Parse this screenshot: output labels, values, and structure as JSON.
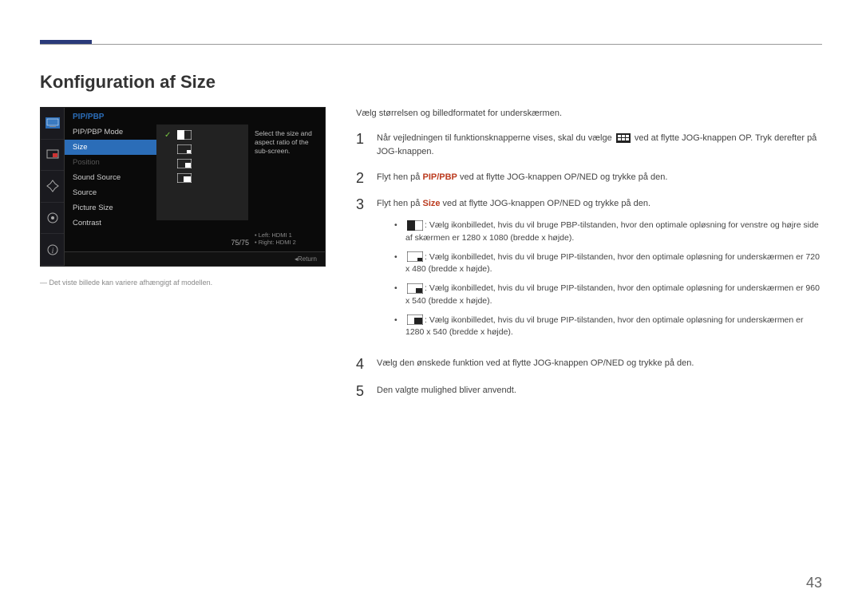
{
  "page": {
    "heading": "Konfiguration af Size",
    "caption": "Det viste billede kan variere afhængigt af modellen.",
    "page_number": "43"
  },
  "osd": {
    "title": "PIP/PBP",
    "items": {
      "mode": "PIP/PBP Mode",
      "size": "Size",
      "position": "Position",
      "sound": "Sound Source",
      "source": "Source",
      "psize": "Picture Size",
      "contrast": "Contrast"
    },
    "contrast_value": "75/75",
    "help_text": "Select the size and aspect ratio of the sub-screen.",
    "help_left": "Left: HDMI 1",
    "help_right": "Right: HDMI 2",
    "return": "Return"
  },
  "instructions": {
    "intro": "Vælg størrelsen og billedformatet for underskærmen.",
    "step1a": "Når vejledningen til funktionsknapperne vises, skal du vælge ",
    "step1b": " ved at flytte JOG-knappen OP. Tryk derefter på JOG-knappen.",
    "step2a": "Flyt hen på ",
    "step2_hl": "PIP/PBP",
    "step2b": " ved at flytte JOG-knappen OP/NED og trykke på den.",
    "step3a": "Flyt hen på ",
    "step3_hl": "Size",
    "step3b": " ved at flytte JOG-knappen OP/NED og trykke på den.",
    "b1": ": Vælg ikonbilledet, hvis du vil bruge PBP-tilstanden, hvor den optimale opløsning for venstre og højre side af skærmen er 1280 x 1080 (bredde x højde).",
    "b2": ": Vælg ikonbilledet, hvis du vil bruge PIP-tilstanden, hvor den optimale opløsning for underskærmen er 720 x 480 (bredde x højde).",
    "b3": ": Vælg ikonbilledet, hvis du vil bruge PIP-tilstanden, hvor den optimale opløsning for underskærmen er 960 x 540 (bredde x højde).",
    "b4": ": Vælg ikonbilledet, hvis du vil bruge PIP-tilstanden, hvor den optimale opløsning for underskærmen er 1280 x 540 (bredde x højde).",
    "step4": "Vælg den ønskede funktion ved at flytte JOG-knappen OP/NED og trykke på den.",
    "step5": "Den valgte mulighed bliver anvendt."
  }
}
